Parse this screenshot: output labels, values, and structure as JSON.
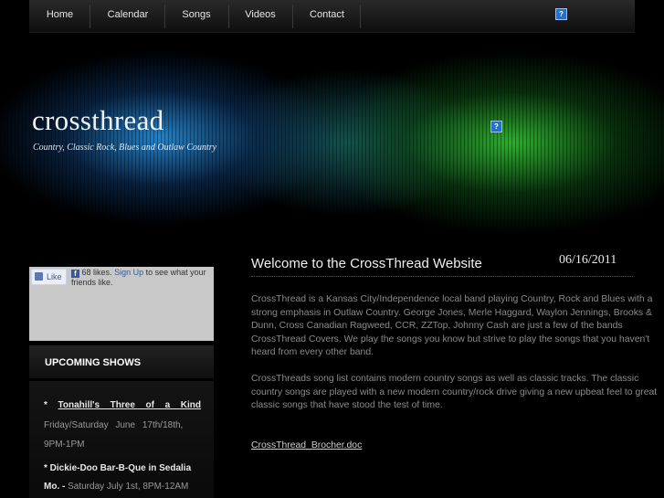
{
  "nav": {
    "items": [
      "Home",
      "Calendar",
      "Songs",
      "Videos",
      "Contact"
    ],
    "help_icon": "?"
  },
  "hero": {
    "title": "crossthread",
    "tagline": "Country, Classic Rock, Blues and Outlaw Country",
    "help_icon": "?"
  },
  "facebook": {
    "like_label": "Like",
    "likes_text": "68 likes.",
    "signup_text": "Sign Up",
    "after_signup": "to see what your friends like.",
    "logo_letter": "f"
  },
  "shows": {
    "title": "UPCOMING SHOWS",
    "item1_bullet": "*",
    "item1_name": "Tonahill's Three of a Kind",
    "item1_when_a": "Friday/Saturday June 17th/18th,",
    "item1_when_b": "9PM-1PM",
    "item2_name": "* Dickie-Doo Bar-B-Que in Sedalia",
    "item2_name_b": "Mo. -",
    "item2_when": "Saturday July 1st, 8PM-12AM"
  },
  "main": {
    "title": "Welcome to the CrossThread Website",
    "date": "06/16/2011",
    "para1": "CrossThread is a Kansas City/Independence local band playing Country, Rock and Blues with a strong emphasis in Outlaw Country. George Jones, Merle Haggard, Waylon Jennings, Brooks & Dunn, Cross Canadian Ragweed, CCR, ZZTop, Johnny Cash are just a few of the bands CrossThread Covers. We play the songs you know but strive to play the songs that you haven't heard from every other band.",
    "para2": "CrossThreads song list contains modern country songs as well as classic tracks. The classic country songs are played with a new modern country/rock drive giving a new upbeat feel to great classic songs that have stood the test of time.",
    "doc_link": "CrossThread_Brocher.doc"
  }
}
